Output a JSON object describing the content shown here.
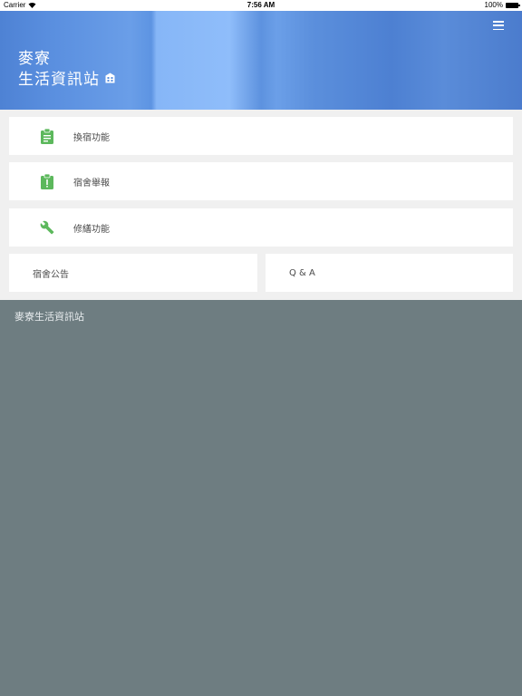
{
  "status_bar": {
    "carrier": "Carrier",
    "time": "7:56 AM",
    "battery": "100%"
  },
  "header": {
    "title_line1": "麥寮",
    "title_line2": "生活資訊站"
  },
  "menu": {
    "items": [
      {
        "label": "換宿功能",
        "icon": "clipboard-icon"
      },
      {
        "label": "宿舍舉報",
        "icon": "clipboard-alert-icon"
      },
      {
        "label": "修繕功能",
        "icon": "wrench-icon"
      }
    ],
    "bottom_left": "宿舍公告",
    "bottom_right": "Q & A"
  },
  "footer": {
    "text": "麥寮生活資訊站"
  },
  "colors": {
    "icon_green": "#5cb85c",
    "hero_blue": "#5a8fdf",
    "background_gray": "#6e7d81",
    "menu_bg": "#f0f0f0"
  }
}
